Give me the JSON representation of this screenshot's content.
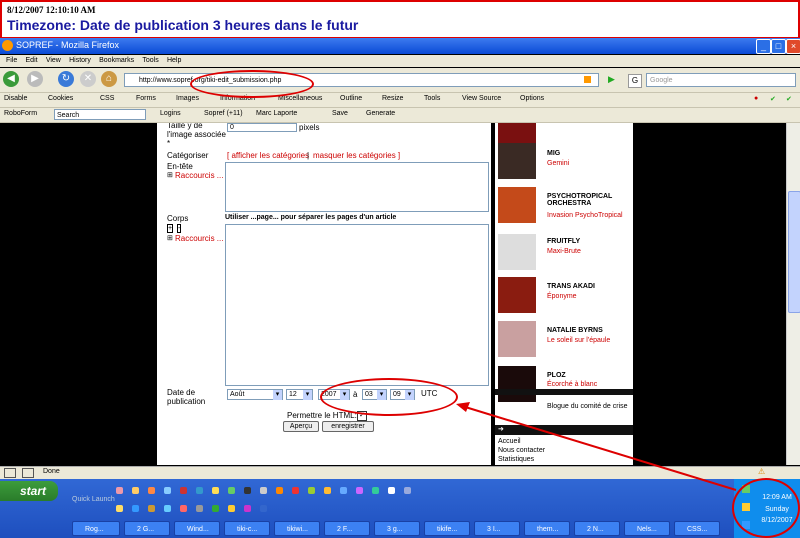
{
  "annotation": {
    "timestamp": "8/12/2007 12:10:10 AM",
    "headline": "Timezone: Date de publication 3 heures dans le futur"
  },
  "window": {
    "title": "SOPREF - Mozilla Firefox"
  },
  "menu": [
    "File",
    "Edit",
    "View",
    "History",
    "Bookmarks",
    "Tools",
    "Help"
  ],
  "address": {
    "url": "http://www.sopref.org/tiki-edit_submission.php",
    "search_placeholder": "Google"
  },
  "webdev_toolbar": [
    "Disable",
    "Cookies",
    "CSS",
    "Forms",
    "Images",
    "Information",
    "Miscellaneous",
    "Outline",
    "Resize",
    "Tools",
    "View Source",
    "Options"
  ],
  "roboform_toolbar": {
    "roboform": "RoboForm",
    "search": "Search",
    "logins": "Logins",
    "sopref": "Sopref (+11)",
    "marc": "Marc Laporte",
    "save": "Save",
    "generate": "Generate"
  },
  "form": {
    "image_size_label": "Taille y de l'image associée *",
    "image_size_value": "0",
    "image_size_unit": "pixels",
    "categorize_label": "Catégoriser",
    "show_categories": "[ afficher les catégories",
    "sep": "|",
    "hide_categories": "masquer les catégories ]",
    "heading_label": "En-tête",
    "shortcuts": "Raccourcis ...",
    "body_label": "Corps",
    "body_hint": "Utiliser ...page... pour séparer les pages d'un article",
    "pubdate_label": "Date de publication",
    "month": "Août",
    "day": "12",
    "year": "2007",
    "at": "à",
    "hour": "03",
    "minute": "09",
    "tz": "UTC",
    "allow_html": "Permettre le HTML:",
    "preview": "Aperçu",
    "save": "enregistrer"
  },
  "sidebar": {
    "albums": [
      {
        "artist": "MIG",
        "album": "Gemini"
      },
      {
        "artist": "PSYCHOTROPICAL ORCHESTRA",
        "album": "Invasion PsychoTropical"
      },
      {
        "artist": "FRUITFLY",
        "album": "Maxi-Brute"
      },
      {
        "artist": "TRANS AKADI",
        "album": "Éponyme"
      },
      {
        "artist": "NATALIE BYRNS",
        "album": "Le soleil sur l'épaule"
      },
      {
        "artist": "PLOZ",
        "album": "Écorché à blanc"
      }
    ],
    "blog": "Blogue du comité de crise",
    "links": [
      "Accueil",
      "Nous contacter",
      "Statistiques"
    ]
  },
  "status": {
    "text": "Done"
  },
  "taskbar": {
    "start": "start",
    "quick_launch": "Quick Launch",
    "tasks": [
      "Rog...",
      "2 G...",
      "Wind...",
      "tiki-c...",
      "tikiwi...",
      "2 F...",
      "3 g...",
      "tikife...",
      "3 I...",
      "them...",
      "2 N...",
      "Nels...",
      "CSS..."
    ],
    "clock_time": "12:09 AM",
    "clock_day": "Sunday",
    "clock_date": "8/12/2007"
  },
  "colors": {
    "accent_red": "#dd0000",
    "headline_blue": "#1a1aa0",
    "xp_blue": "#245edb"
  }
}
